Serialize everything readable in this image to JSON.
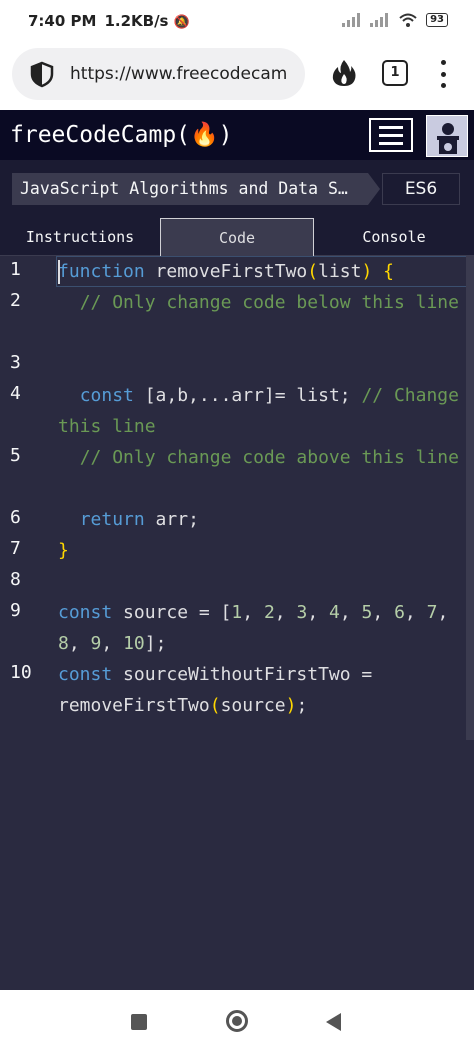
{
  "status": {
    "time": "7:40 PM",
    "speed": "1.2KB/s",
    "battery": "93"
  },
  "browser": {
    "url": "https://www.freecodecamp.org",
    "tab_count": "1"
  },
  "nav": {
    "logo": "freeCodeCamp(🔥)"
  },
  "breadcrumb": {
    "section": "JavaScript Algorithms and Data Structures",
    "section_display": "JavaScript Algorithms and Data S…",
    "subsection": "ES6"
  },
  "tabs": {
    "instructions": "Instructions",
    "code": "Code",
    "console": "Console"
  },
  "editor": {
    "line_numbers": [
      "1",
      "2",
      "3",
      "4",
      "5",
      "6",
      "7",
      "8",
      "9",
      "10"
    ]
  },
  "colors": {
    "keyword": "#569cd6",
    "comment": "#6a9955",
    "bracket": "#ffd700",
    "editor_bg": "#2a2a40",
    "nav_bg": "#0a0a23"
  }
}
